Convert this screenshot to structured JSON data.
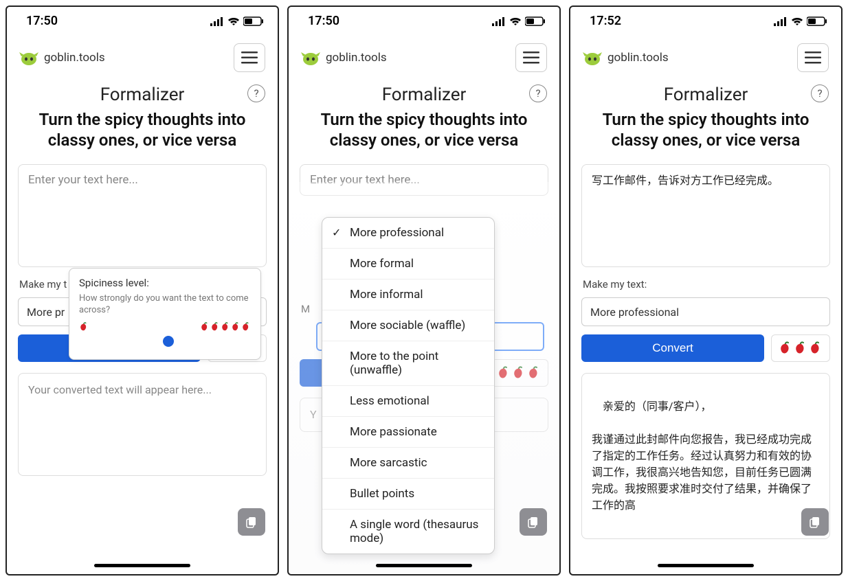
{
  "status": {
    "time_a": "17:50",
    "time_b": "17:50",
    "time_c": "17:52",
    "battery": "47"
  },
  "brand": {
    "name": "goblin.tools"
  },
  "header": {
    "title": "Formalizer",
    "subtitle": "Turn the spicy thoughts into classy ones, or vice versa",
    "help": "?"
  },
  "input": {
    "placeholder": "Enter your text here...",
    "value_c": "写工作邮件，告诉对方工作已经完成。"
  },
  "make_label": "Make my text:",
  "make_label_short": "Make my t",
  "make_label_letter": "M",
  "select": {
    "value_a": "More pr",
    "value_c": "More professional",
    "options": [
      "More professional",
      "More formal",
      "More informal",
      "More sociable (waffle)",
      "More to the point (unwaffle)",
      "Less emotional",
      "More passionate",
      "More sarcastic",
      "Bullet points",
      "A single word (thesaurus mode)"
    ],
    "selected_index": 0
  },
  "convert": {
    "label": "Convert"
  },
  "spiciness_count": 3,
  "output": {
    "placeholder": "Your converted text will appear here...",
    "placeholder_short": "Y",
    "value_c": "亲爱的（同事/客户），\n\n我谨通过此封邮件向您报告，我已经成功完成了指定的工作任务。经过认真努力和有效的协调工作，我很高兴地告知您，目前任务已圆满完成。我按照要求准时交付了结果，并确保了工作的高"
  },
  "tooltip": {
    "title": "Spiciness level:",
    "body": "How strongly do you want the text to come across?"
  }
}
